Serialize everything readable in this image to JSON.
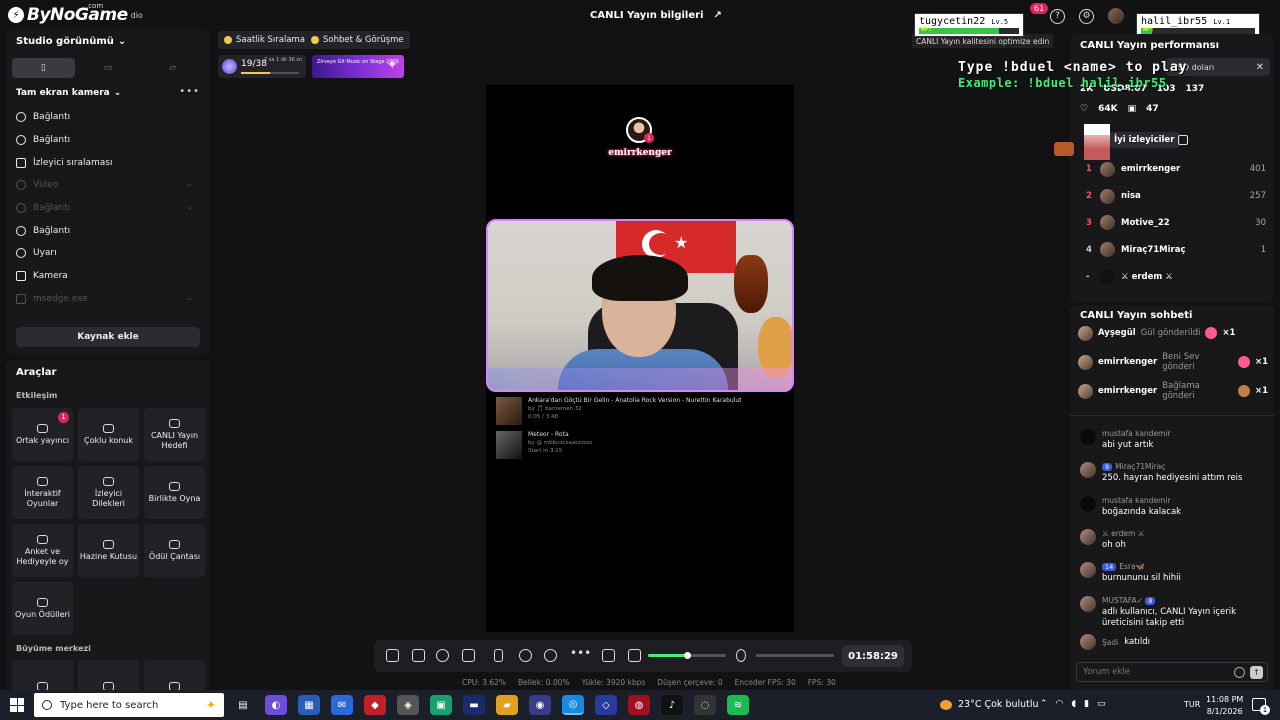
{
  "app": {
    "logo_mark": "⚡",
    "logo_name": "ByNoGame",
    "logo_suffix": "dio",
    "logo_com": ".com",
    "top_title": "CANLI Yayın bilgileri",
    "notif_count": "61",
    "quality_tip": "CANLI Yayın kalitesini optimize edin"
  },
  "players": [
    {
      "name": "tugycetin22",
      "level": "Lv.5",
      "hp_label": "HP:",
      "hp": 0.8
    },
    {
      "name": "halil_ibr55",
      "level": "Lv.1",
      "hp_label": "HP:",
      "hp": 0.1
    }
  ],
  "overlay": {
    "line1": "Type !bduel <name> to play",
    "line2": "Example: !bduel halil_ibr55"
  },
  "studio": {
    "view_label": "Studio görünümü",
    "view_tabs": [
      "▯",
      "▭",
      "▱"
    ],
    "section_label": "Tam ekran kamera",
    "sources": [
      {
        "label": "Bağlantı",
        "dim": false
      },
      {
        "label": "Bağlantı",
        "dim": false
      },
      {
        "label": "İzleyici sıralaması",
        "dim": false
      },
      {
        "label": "Video",
        "dim": true
      },
      {
        "label": "Bağlantı",
        "dim": true
      },
      {
        "label": "Bağlantı",
        "dim": false
      },
      {
        "label": "Uyarı",
        "dim": false
      },
      {
        "label": "Kamera",
        "dim": false
      },
      {
        "label": "msedge.exe",
        "dim": true
      }
    ],
    "add_source": "Kaynak ekle"
  },
  "tools": {
    "title": "Araçlar",
    "engagement_label": "Etkileşim",
    "engagement": [
      {
        "label": "Ortak yayıncı",
        "badge": "1"
      },
      {
        "label": "Çoklu konuk",
        "badge": ""
      },
      {
        "label": "CANLI Yayın Hedefi",
        "badge": ""
      },
      {
        "label": "İnteraktif Oyunlar",
        "badge": ""
      },
      {
        "label": "İzleyici Dilekleri",
        "badge": ""
      },
      {
        "label": "Birlikte Oyna",
        "badge": ""
      },
      {
        "label": "Anket ve Hediyeyle oy",
        "badge": ""
      },
      {
        "label": "Hazine Kutusu",
        "badge": ""
      },
      {
        "label": "Ödül Çantası",
        "badge": ""
      },
      {
        "label": "Oyun Ödülleri",
        "badge": ""
      }
    ],
    "growth_label": "Büyüme merkezi"
  },
  "pills": {
    "hourly_rank": "Saatlik Sıralama",
    "chat_meet": "Sohbet & Görüşme",
    "progress_num": "19/38",
    "progress_time": "2 sa 1 dk 36 sn",
    "progress": 0.5,
    "promo_text": "Zirveye Git Music on Stage 2026"
  },
  "preview": {
    "username": "emirrkenger",
    "avatar_badge": "1",
    "songs": [
      {
        "title": "Ankara'dan Göçtü Bir Gelin - Anatolia Rock Version - Nurettin Karabulut",
        "by": "by 🎵 baroemen 32",
        "time": "0:05 / 3:48"
      },
      {
        "title": "Meteor - Rota",
        "by": "by @ mbbcocsaaszzzzz",
        "time": "Start in 3:15"
      }
    ]
  },
  "controls": {
    "volume": 0.5,
    "timer": "01:58:29"
  },
  "stats": {
    "cpu": "CPU: 3.62%",
    "mem": "Bellek: 0.00%",
    "upload": "Yükle: 3920 kbps",
    "drop": "Düşen çerçeve: 0",
    "enc_fps": "Encoder FPS: 30",
    "fps": "FPS: 30"
  },
  "performance": {
    "title": "CANLI Yayın performansı",
    "tooltip": "USD doları",
    "viewers": "2K",
    "usd": "USD8.07",
    "likes_split": "103",
    "followers": "137",
    "likes": "64K",
    "gifts": "47",
    "top_viewers_label": "İyi izleyiciler",
    "ranking": [
      {
        "rank": "1",
        "name": "emirrkenger",
        "value": "401"
      },
      {
        "rank": "2",
        "name": "nisa",
        "value": "257"
      },
      {
        "rank": "3",
        "name": "Motive_22",
        "value": "30"
      },
      {
        "rank": "4",
        "name": "Miraç71Miraç",
        "value": "1"
      },
      {
        "rank": "-",
        "name": "⚔ erdem ⚔",
        "value": ""
      }
    ]
  },
  "chat": {
    "title": "CANLI Yayın sohbeti",
    "gifts": [
      {
        "user": "Ayşegül",
        "action": "Gül gönderildi",
        "count": "×1"
      },
      {
        "user": "emirrkenger",
        "action": "Beni Sev gönderi",
        "count": "×1"
      },
      {
        "user": "emirrkenger",
        "action": "Bağlama gönderi",
        "count": "×1"
      }
    ],
    "messages": [
      {
        "user": "mustafa kandemir",
        "level": "",
        "text": "abi yut artık"
      },
      {
        "user": "Miraç71Miraç",
        "level": "9",
        "text": "250. hayran hediyesini attım reis"
      },
      {
        "user": "mustafa kandemir",
        "level": "",
        "text": "boğazında kalacak"
      },
      {
        "user": "⚔ erdem ⚔",
        "level": "",
        "text": "oh oh"
      },
      {
        "user": "Esra🦋",
        "level": "14",
        "text": "burnununu sil hihii"
      },
      {
        "user": "MUSTAFA✓",
        "level": "8",
        "text": "adlı kullanıcı, CANLI Yayın içerik üreticisini takip etti"
      },
      {
        "user": "Şadi",
        "level": "",
        "text": "katıldı"
      }
    ],
    "input_placeholder": "Yorum ekle"
  },
  "taskbar": {
    "search_placeholder": "Type here to search",
    "weather": "23°C  Çok bulutlu",
    "lang": "TUR",
    "time": "11:08 PM",
    "date": "8/1/2026",
    "notif": "1"
  }
}
